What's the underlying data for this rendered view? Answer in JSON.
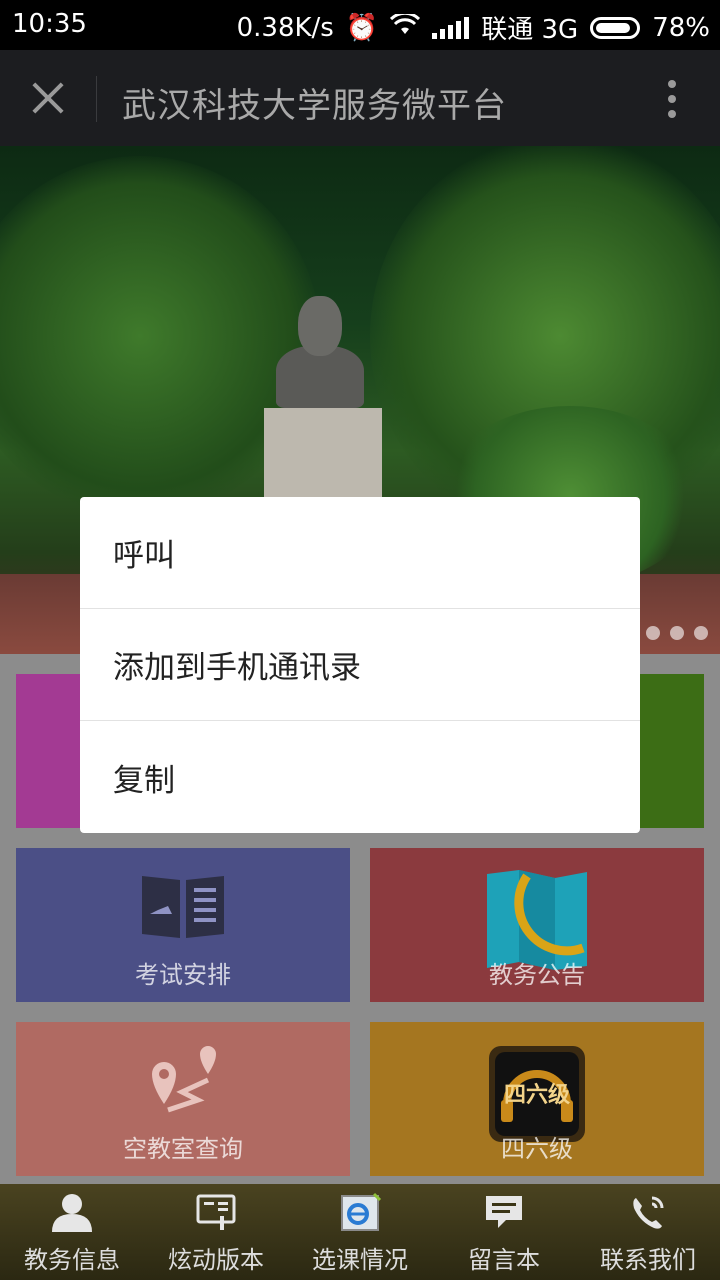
{
  "status_bar": {
    "time": "10:35",
    "speed": "0.38K/s",
    "carrier": "联通 3G",
    "battery": "78%"
  },
  "title_bar": {
    "title": "武汉科技大学服务微平台"
  },
  "dialog": {
    "items": [
      {
        "label": "呼叫"
      },
      {
        "label": "添加到手机通讯录"
      },
      {
        "label": "复制"
      }
    ]
  },
  "tiles": [
    {
      "label": "",
      "color": "#a33a93"
    },
    {
      "label": "",
      "color": "#3c6d15"
    },
    {
      "label": "考试安排",
      "icon": "book-icon",
      "color": "#4b4f86"
    },
    {
      "label": "教务公告",
      "icon": "map-icon",
      "color": "#8b3a3e"
    },
    {
      "label": "空教室查询",
      "icon": "route-pin-icon",
      "color": "#b06a62"
    },
    {
      "label": "四六级",
      "icon": "cet-badge-icon",
      "badge_text": "四六级",
      "color": "#a57620"
    }
  ],
  "bottom_nav": [
    {
      "label": "教务信息",
      "icon": "person-icon"
    },
    {
      "label": "炫动版本",
      "icon": "reader-icon"
    },
    {
      "label": "选课情况",
      "icon": "browser-icon"
    },
    {
      "label": "留言本",
      "icon": "message-icon"
    },
    {
      "label": "联系我们",
      "icon": "phone-icon"
    }
  ]
}
